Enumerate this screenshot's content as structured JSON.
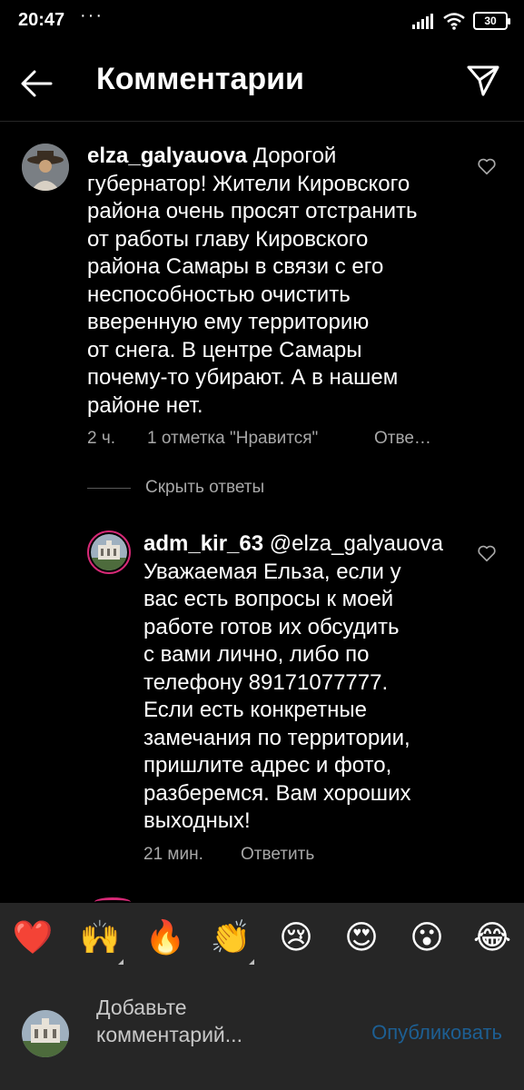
{
  "status_bar": {
    "time": "20:47",
    "dots": "···",
    "battery": "30"
  },
  "header": {
    "title": "Комментарии"
  },
  "comment": {
    "username": "elza_galyauova",
    "lines": [
      "Дорогой",
      "губернатор! Жители Кировского",
      "района очень просят отстранить",
      "от работы главу Кировского",
      "района Самары в связи с его",
      "неспособностью очистить",
      "вверенную ему территорию",
      "от снега. В центре Самары",
      "почему-то убирают. А в нашем",
      "районе нет."
    ],
    "time": "2 ч.",
    "likes": "1 отметка \"Нравится\"",
    "reply": "Отве…"
  },
  "hide_replies": "Скрыть ответы",
  "reply_comment": {
    "username": "adm_kir_63",
    "mention": "@elza_galyauova",
    "lines": [
      "Уважаемая Ельза, если у",
      "вас есть вопросы к моей",
      "работе готов их обсудить",
      "с вами лично, либо по",
      "телефону 89171077777.",
      "Если есть конкретные",
      "замечания по территории,",
      "пришлите адрес и фото,",
      "разберемся. Вам хороших",
      "выходных!"
    ],
    "time": "21 мин.",
    "reply": "Ответить"
  },
  "emoji_bar": [
    "❤️",
    "🙌",
    "🔥",
    "👏",
    "😢",
    "😍",
    "😮",
    "😂"
  ],
  "composer": {
    "placeholder_line1": "Добавьте",
    "placeholder_line2": "комментарий...",
    "publish": "Опубликовать"
  },
  "colors": {
    "background": "#000000",
    "panel": "#262626",
    "secondary_text": "#a8a8a8",
    "publish_disabled": "#1d5f93"
  }
}
